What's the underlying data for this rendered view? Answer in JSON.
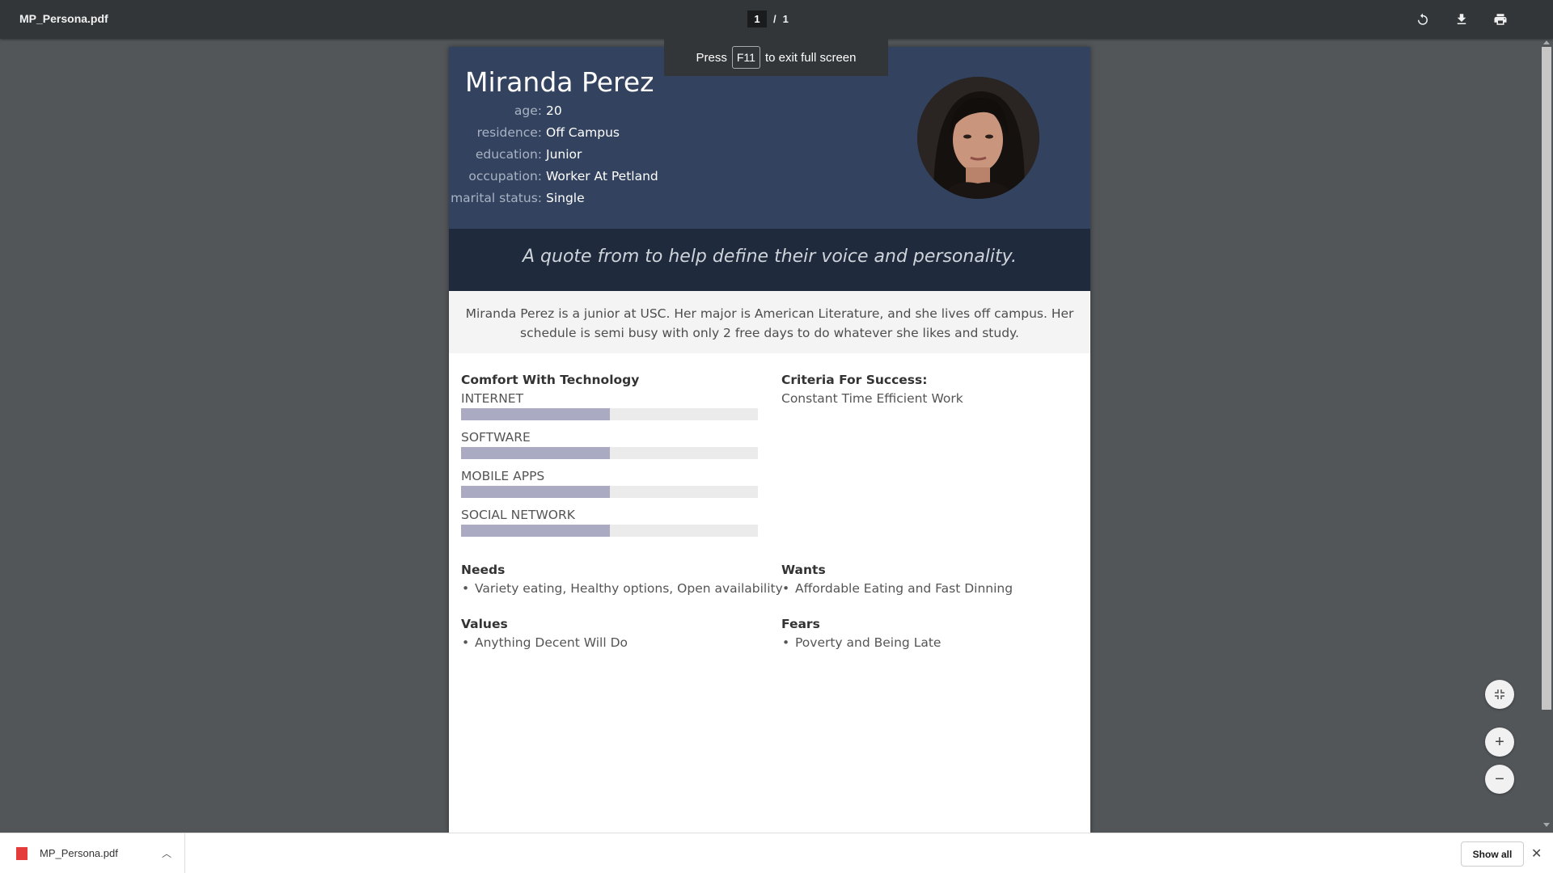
{
  "toolbar": {
    "doc_title": "MP_Persona.pdf",
    "page_current": "1",
    "page_sep": "/",
    "page_total": "1"
  },
  "toast": {
    "press": "Press",
    "key": "F11",
    "rest": "to exit full screen"
  },
  "persona": {
    "name": "Miranda Perez",
    "attributes": [
      {
        "key": "age:",
        "value": "20"
      },
      {
        "key": "residence:",
        "value": "Off Campus"
      },
      {
        "key": "education:",
        "value": "Junior"
      },
      {
        "key": "occupation:",
        "value": "Worker At Petland"
      },
      {
        "key": "marital status:",
        "value": "Single"
      }
    ],
    "quote": "A quote from to help define their voice and personality.",
    "bio": "Miranda Perez is a junior at USC. Her major is American Literature, and she lives off campus. Her schedule is semi busy with only 2 free days to do whatever she likes and study.",
    "tech": {
      "title": "Comfort With Technology",
      "bars": [
        {
          "label": "INTERNET",
          "level": 0.5
        },
        {
          "label": "SOFTWARE",
          "level": 0.5
        },
        {
          "label": "MOBILE APPS",
          "level": 0.5
        },
        {
          "label": "SOCIAL NETWORK",
          "level": 0.5
        }
      ]
    },
    "criteria": {
      "title": "Criteria For Success:",
      "text": "Constant Time Efficient Work"
    },
    "needs": {
      "title": "Needs",
      "items": [
        "Variety eating, Healthy options, Open availability"
      ]
    },
    "wants": {
      "title": "Wants",
      "items": [
        "Affordable Eating and Fast Dinning"
      ]
    },
    "values": {
      "title": "Values",
      "items": [
        "Anything Decent Will Do"
      ]
    },
    "fears": {
      "title": "Fears",
      "items": [
        "Poverty and Being Late"
      ]
    }
  },
  "download_bar": {
    "file_name": "MP_Persona.pdf",
    "show_all": "Show all"
  },
  "colors": {
    "header_bg": "#33435f",
    "quote_bg": "#1f2a3d",
    "bar_fill": "#abaac3",
    "bar_track": "#ebebeb"
  },
  "icons": {
    "rotate": "rotate-icon",
    "download": "download-icon",
    "print": "print-icon",
    "fit": "fit-to-page-icon",
    "zoom_in": "zoom-in-icon",
    "zoom_out": "zoom-out-icon",
    "pdf_file": "pdf-file-icon",
    "chevron_up": "chevron-up-icon",
    "close": "close-icon"
  }
}
